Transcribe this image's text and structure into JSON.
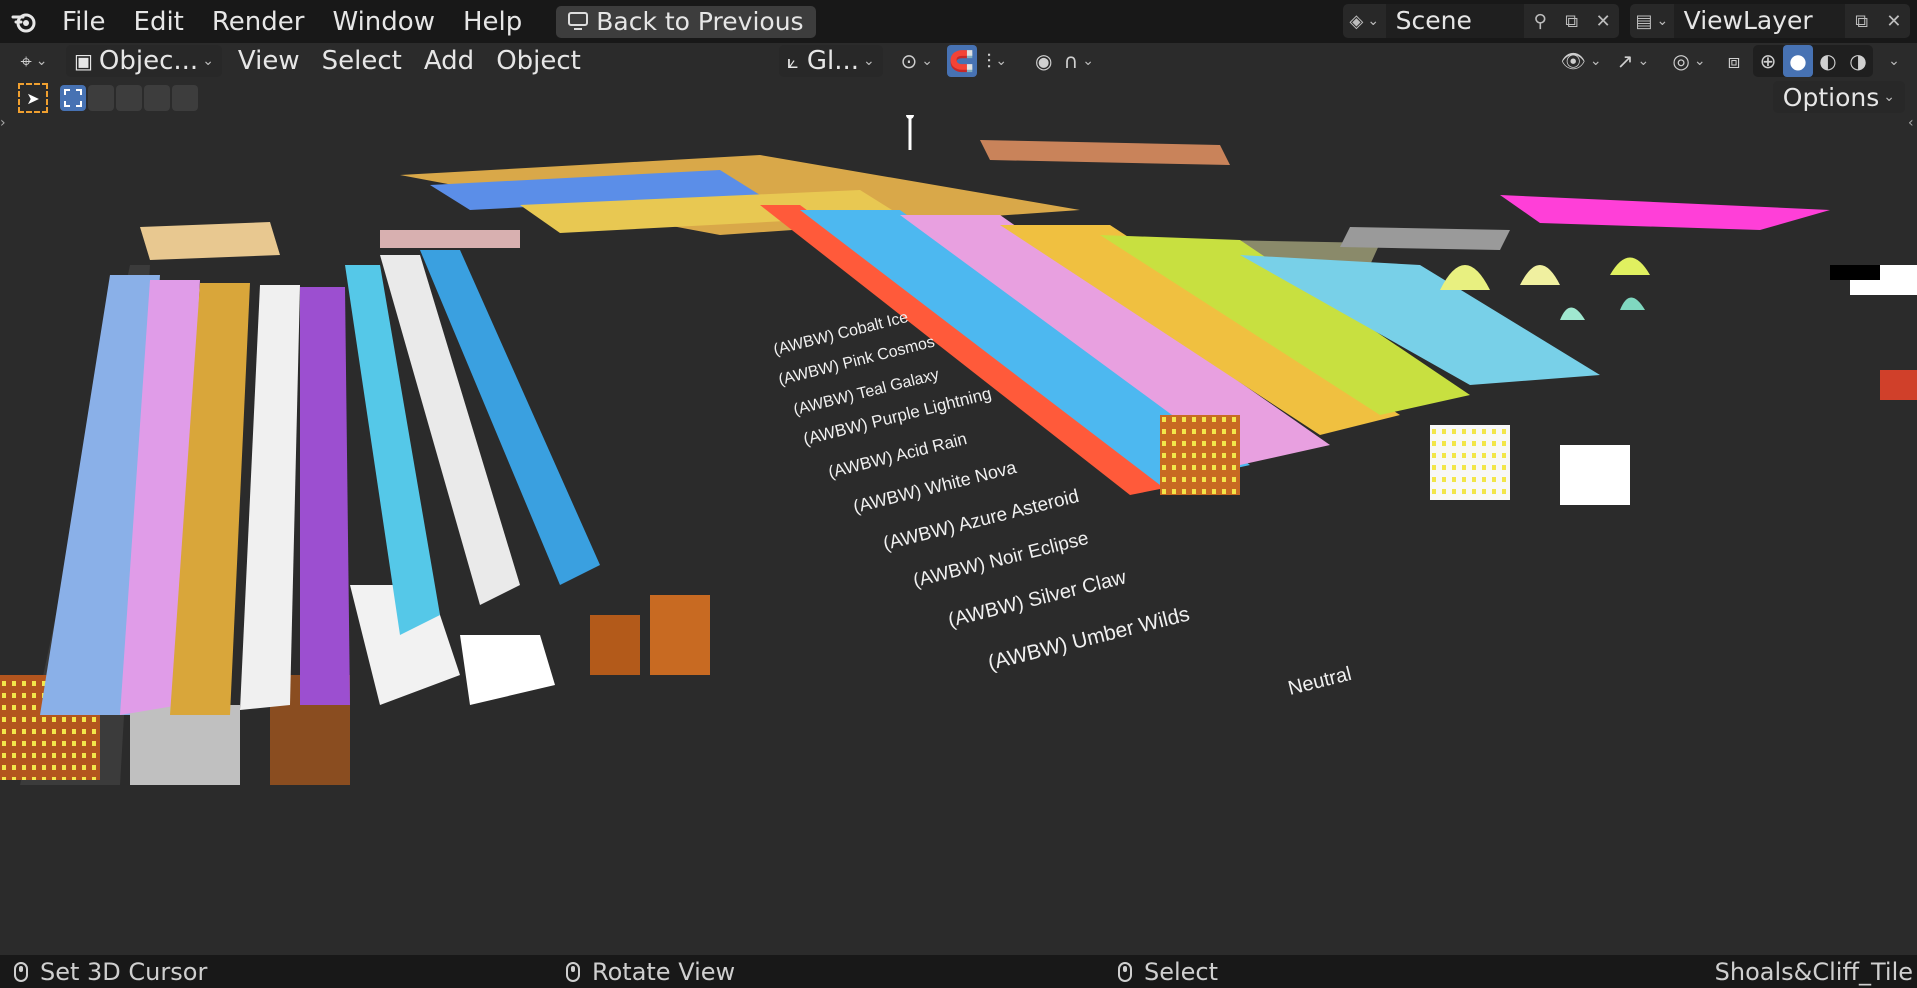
{
  "menu": {
    "file": "File",
    "edit": "Edit",
    "render": "Render",
    "window": "Window",
    "help": "Help",
    "back": "Back to Previous"
  },
  "scene": {
    "name": "Scene"
  },
  "view_layer": {
    "name": "ViewLayer"
  },
  "header": {
    "mode": "Objec...",
    "view": "View",
    "select": "Select",
    "add": "Add",
    "object": "Object",
    "transform_orientation": "Gl..."
  },
  "options": "Options",
  "viewport_labels": [
    "(AWBW)  Cobalt Ice",
    "(AWBW)  Pink Cosmos",
    "(AWBW)  Teal Galaxy",
    "(AWBW)  Purple Lightning",
    "(AWBW)  Acid Rain",
    "(AWBW)  White Nova",
    "(AWBW)  Azure Asteroid",
    "(AWBW)  Noir Eclipse",
    "(AWBW)  Silver Claw",
    "(AWBW)  Umber Wilds",
    "Neutral"
  ],
  "status": {
    "left": "Set 3D Cursor",
    "middle": "Rotate View",
    "right": "Select",
    "active_object": "Shoals&Cliff_Tile"
  },
  "colors": {
    "topbar": "#181818",
    "viewport": "#2b2b2b",
    "accent": "#4772b3"
  }
}
